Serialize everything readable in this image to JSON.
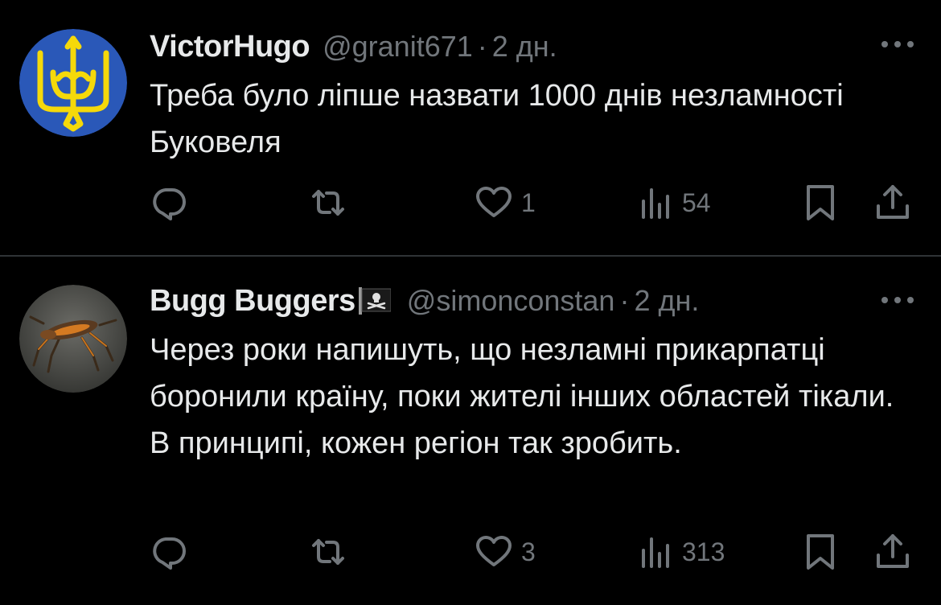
{
  "tweets": [
    {
      "display_name": "VictorHugo",
      "handle": "@granit671",
      "separator": "·",
      "time": "2 дн.",
      "text": "Треба було ліпше назвати 1000 днів незламності Буковеля",
      "stats": {
        "replies": "",
        "retweets": "",
        "likes": "1",
        "views": "54"
      },
      "avatar": "ukrainian-trident-avatar"
    },
    {
      "display_name": "Bugg Buggers",
      "handle": "@simonconstan",
      "separator": "·",
      "time": "2 дн.",
      "text": "Через роки напишуть, що незламні прикарпатці боронили країну, поки жителі інших областей тікали. В принципі, кожен регіон так зробить.",
      "stats": {
        "replies": "",
        "retweets": "",
        "likes": "3",
        "views": "313"
      },
      "avatar": "alien-bug-avatar",
      "name_emoji": "pirate-flag"
    }
  ],
  "icons": {
    "reply": "reply-icon",
    "retweet": "retweet-icon",
    "like": "heart-icon",
    "views": "views-icon",
    "bookmark": "bookmark-icon",
    "share": "share-icon",
    "more": "more-icon"
  },
  "colors": {
    "background": "#000000",
    "text_primary": "#e7e9ea",
    "text_secondary": "#71767b",
    "divider": "#2f3336",
    "ukraine_blue": "#2a58b8",
    "ukraine_yellow": "#f5d90a"
  }
}
